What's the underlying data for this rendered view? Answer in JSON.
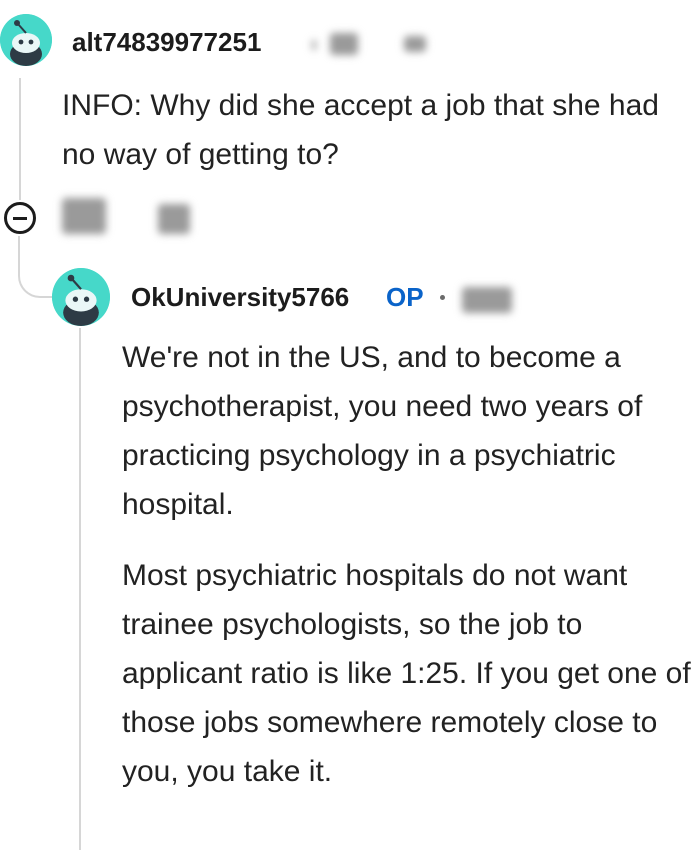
{
  "comment": {
    "username": "alt74839977251",
    "icon": "snoo-avatar-icon",
    "text": "INFO: Why did she accept a job that she had no way of getting to?"
  },
  "reply": {
    "username": "OkUniversity5766",
    "op_label": "OP",
    "icon": "snoo-avatar-icon",
    "paragraphs": [
      "We're not in the US, and to become a psychotherapist, you need two years of practicing psychology in a psychiatric hospital.",
      "Most psychiatric hospitals do not want trainee psychologists, so the job to applicant ratio is like 1:25. If you get one of those jobs somewhere remotely close to you, you take it."
    ]
  },
  "colors": {
    "avatar": "#46d8c9",
    "op_badge": "#0a63c9",
    "thread_line": "#d6d6d6"
  }
}
